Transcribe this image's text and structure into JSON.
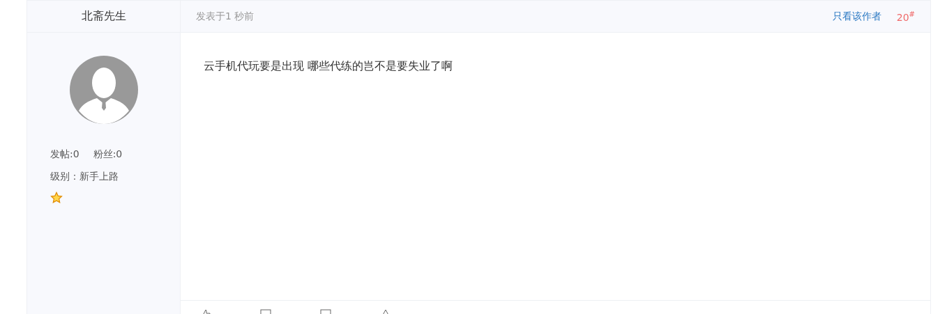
{
  "author": {
    "name": "北斋先生",
    "posts": "发帖:0",
    "fans": "粉丝:0",
    "level": "级别：新手上路"
  },
  "post": {
    "time": "发表于1 秒前",
    "only_author": "只看该作者",
    "floor": "20",
    "floor_mark": "#",
    "content": "云手机代玩要是出现 哪些代练的岂不是要失业了啊"
  }
}
